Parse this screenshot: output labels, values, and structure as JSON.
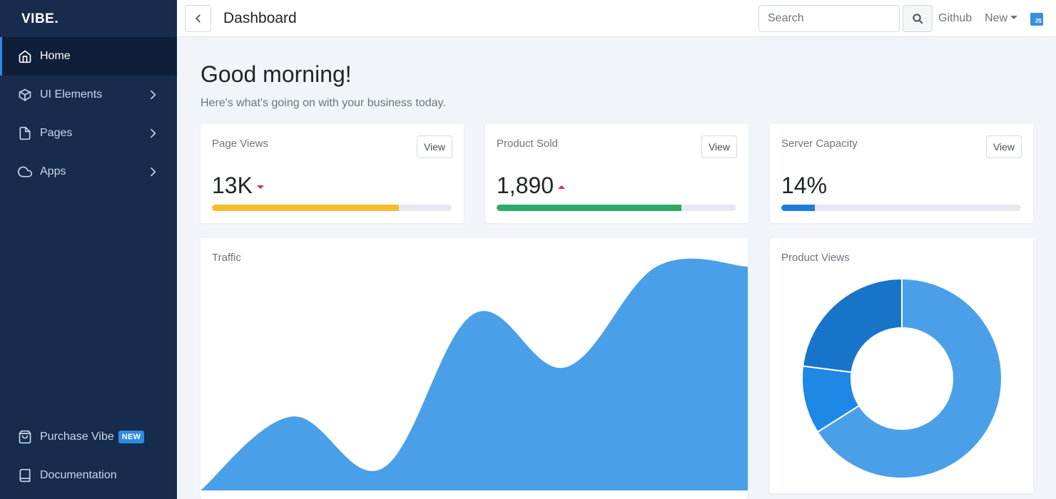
{
  "sidebar": {
    "brand": "VIBE.",
    "items": [
      {
        "label": "Home",
        "icon": "home-icon"
      },
      {
        "label": "UI Elements",
        "icon": "box-icon"
      },
      {
        "label": "Pages",
        "icon": "file-icon"
      },
      {
        "label": "Apps",
        "icon": "cloud-icon"
      }
    ],
    "bottom": [
      {
        "label": "Purchase Vibe",
        "badge": "NEW",
        "icon": "shopping-bag-icon"
      },
      {
        "label": "Documentation",
        "icon": "book-icon"
      }
    ]
  },
  "header": {
    "title": "Dashboard",
    "search_placeholder": "Search",
    "github": "Github",
    "new": "New",
    "logo_text": "JS"
  },
  "main": {
    "greeting": "Good morning!",
    "subtitle": "Here's what's going on with your business today.",
    "stats": [
      {
        "label": "Page Views",
        "value": "13K",
        "trend": "down",
        "progress": 0.78,
        "color": "#f6bc2f",
        "button": "View"
      },
      {
        "label": "Product Sold",
        "value": "1,890",
        "trend": "up",
        "progress": 0.77,
        "color": "#2eab67",
        "button": "View"
      },
      {
        "label": "Server Capacity",
        "value": "14%",
        "trend": "none",
        "progress": 0.14,
        "color": "#1f7ae0",
        "button": "View"
      }
    ],
    "traffic_title": "Traffic",
    "product_views_title": "Product Views"
  },
  "colors": {
    "sidebar_bg": "#172b4d",
    "accent": "#2f8ae5",
    "chart_fill": "#4aa0e8"
  },
  "chart_data": [
    {
      "type": "area",
      "title": "Traffic",
      "x": [
        0,
        1,
        2,
        3,
        4,
        5,
        6
      ],
      "values": [
        0,
        33,
        10,
        79,
        55,
        100,
        100
      ]
    },
    {
      "type": "pie",
      "title": "Product Views",
      "donut": true,
      "values": [
        66,
        11,
        23
      ],
      "colors": [
        "#4aa0e8",
        "#1f88e5",
        "#1874c9"
      ]
    }
  ]
}
